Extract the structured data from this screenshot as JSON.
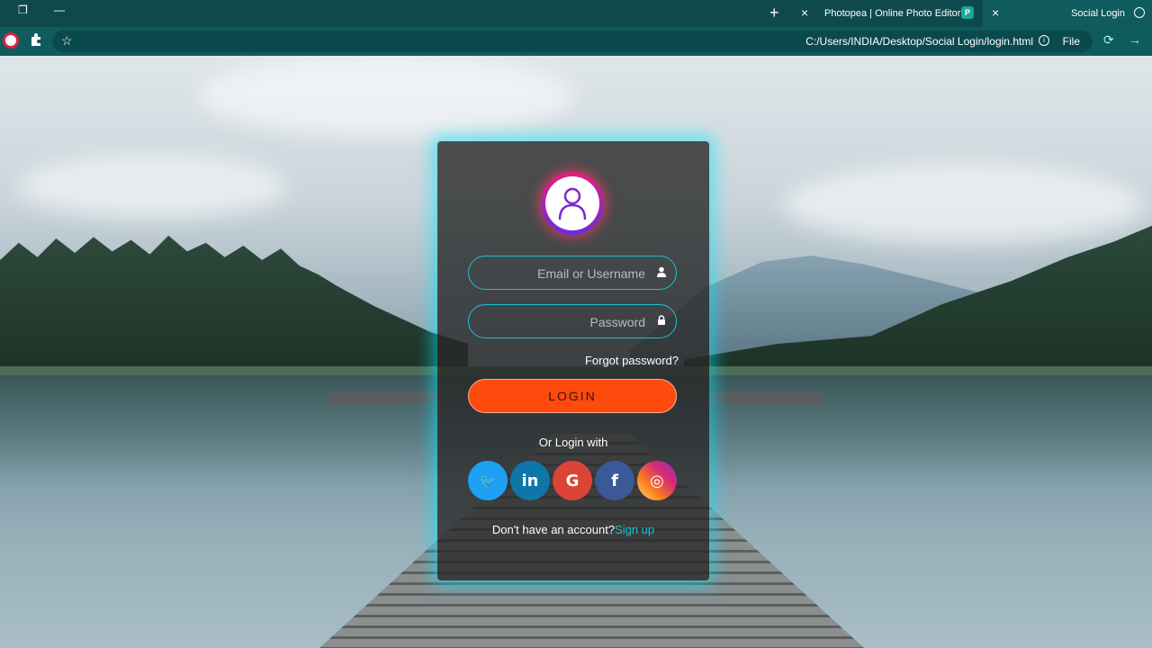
{
  "browser": {
    "tabs": [
      {
        "title": "Social Login",
        "active": true
      },
      {
        "title": "Photopea | Online Photo Editor",
        "active": false
      }
    ],
    "new_tab": "+",
    "close_glyph": "×",
    "address": {
      "scheme_label": "File",
      "url": "C:/Users/INDIA/Desktop/Social Login/login.html"
    }
  },
  "login": {
    "email_placeholder": "Email or Username",
    "password_placeholder": "Password",
    "forgot": "Forgot password?",
    "button": "LOGIN",
    "or_login_with": "Or Login with",
    "social": [
      {
        "name": "instagram",
        "glyph": "◎",
        "color": "#d62976"
      },
      {
        "name": "facebook",
        "glyph": "f",
        "color": "#3b5998"
      },
      {
        "name": "google",
        "glyph": "G",
        "color": "#db4437"
      },
      {
        "name": "linkedin",
        "glyph": "in",
        "color": "#0e76a8"
      },
      {
        "name": "twitter",
        "glyph": "🐦",
        "color": "#1da1f2"
      }
    ],
    "signup_text": "Don't have an account?",
    "signup_link": "Sign up"
  },
  "colors": {
    "accent": "#19c3d1",
    "login_button": "#ff4a0d"
  }
}
